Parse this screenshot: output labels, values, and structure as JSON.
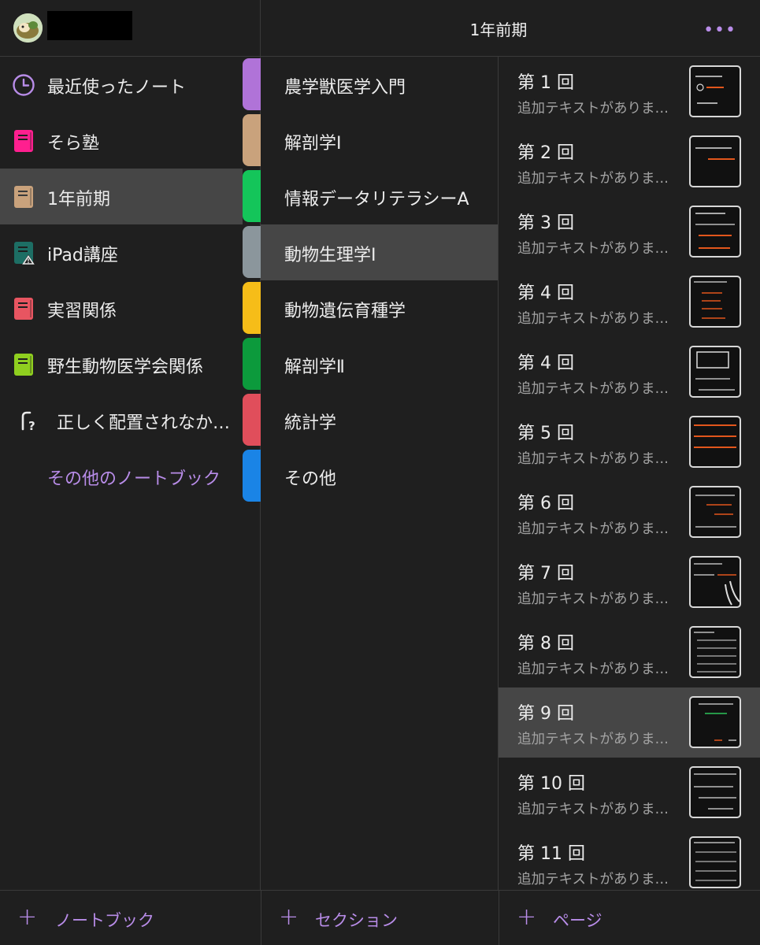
{
  "header": {
    "title": "1年前期",
    "more_label": "•••"
  },
  "notebooks": [
    {
      "label": "最近使ったノート",
      "icon": "clock-icon"
    },
    {
      "label": "そら塾",
      "icon": "notebook-icon",
      "color": "#ff1f8f"
    },
    {
      "label": "1年前期",
      "icon": "notebook-icon",
      "color": "#c9a27c"
    },
    {
      "label": "iPad講座",
      "icon": "notebook-warning-icon",
      "color": "#1d6e64"
    },
    {
      "label": "実習関係",
      "icon": "notebook-icon",
      "color": "#e85561"
    },
    {
      "label": "野生動物医学会関係",
      "icon": "notebook-icon",
      "color": "#8fcf1f"
    },
    {
      "label": "正しく配置されなか…",
      "icon": "misplaced-section-icon"
    },
    {
      "label": "その他のノートブック"
    }
  ],
  "section_tab_colors": [
    "#b073d8",
    "#c9a27c",
    "#14c55a",
    "#8b969c",
    "#f6bd18",
    "#0c9a3c",
    "#e04e5b",
    "#1a84e6"
  ],
  "sections": [
    {
      "label": "農学獣医学入門"
    },
    {
      "label": "解剖学Ⅰ"
    },
    {
      "label": "情報データリテラシーA"
    },
    {
      "label": "動物生理学Ⅰ"
    },
    {
      "label": "動物遺伝育種学"
    },
    {
      "label": "解剖学Ⅱ"
    },
    {
      "label": "統計学"
    },
    {
      "label": "その他"
    }
  ],
  "pages": [
    {
      "title": "第 1 回",
      "subtitle": "追加テキストがありま…"
    },
    {
      "title": "第 2 回",
      "subtitle": "追加テキストがありま…"
    },
    {
      "title": "第 3 回",
      "subtitle": "追加テキストがありま…"
    },
    {
      "title": "第 4 回",
      "subtitle": "追加テキストがありま…"
    },
    {
      "title": "第 4 回",
      "subtitle": "追加テキストがありま…"
    },
    {
      "title": "第 5 回",
      "subtitle": "追加テキストがありま…"
    },
    {
      "title": "第 6 回",
      "subtitle": "追加テキストがありま…"
    },
    {
      "title": "第 7 回",
      "subtitle": "追加テキストがありま…"
    },
    {
      "title": "第 8 回",
      "subtitle": "追加テキストがありま…"
    },
    {
      "title": "第 9 回",
      "subtitle": "追加テキストがありま…"
    },
    {
      "title": "第 10 回",
      "subtitle": "追加テキストがありま…"
    },
    {
      "title": "第 11 回",
      "subtitle": "追加テキストがありま…"
    }
  ],
  "footer": {
    "add_notebook": "ノートブック",
    "add_section": "セクション",
    "add_page": "ページ",
    "plus_symbol": "+"
  },
  "colors": {
    "accent": "#b88ce8",
    "background": "#1f1f1f",
    "selected": "#464646"
  }
}
